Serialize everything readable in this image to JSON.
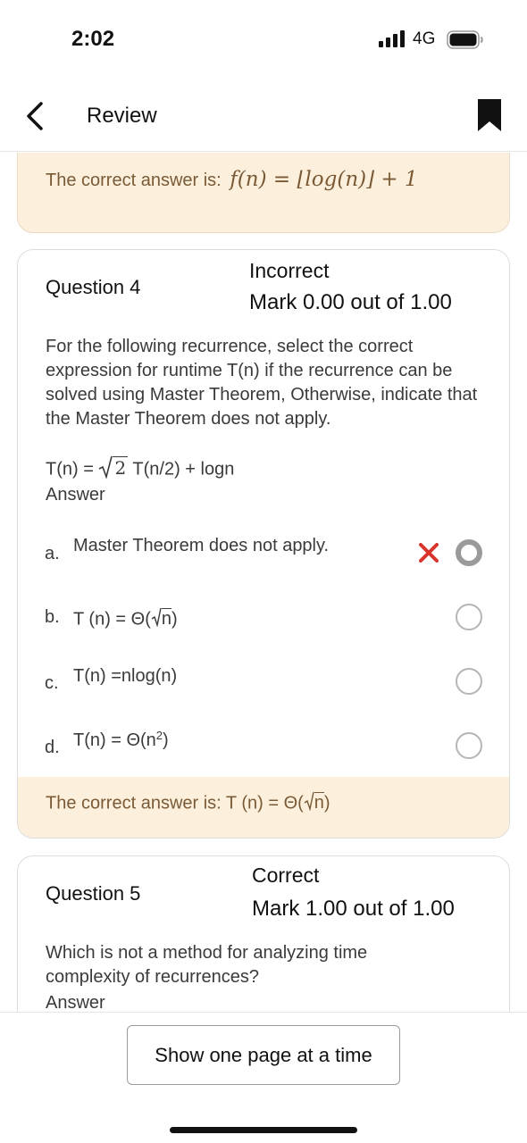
{
  "status_bar": {
    "time": "2:02",
    "network": "4G"
  },
  "nav": {
    "title": "Review"
  },
  "previous": {
    "answer_prefix": "The correct answer is:",
    "answer_math": "f(n) = ⌊log(n)⌋ + 1"
  },
  "question4": {
    "number": "Question 4",
    "status": "Incorrect",
    "mark": "Mark 0.00 out of 1.00",
    "text": "For the following recurrence, select the correct expression for runtime T(n) if the recurrence can be solved using Master Theorem, Otherwise, indicate that the Master Theorem does not apply.",
    "equation_left": "T(n) =",
    "equation_radicand": "2",
    "equation_right": "T(n/2) + logn",
    "answer_label": "Answer",
    "options": [
      {
        "letter": "a.",
        "text": "Master Theorem does not apply.",
        "selected": true,
        "marked_incorrect": true
      },
      {
        "letter": "b.",
        "text_before": "T (n) = Θ(",
        "text_radicand": "n",
        "text_after": ")",
        "selected": false
      },
      {
        "letter": "c.",
        "text": "T(n) =nlog(n)",
        "selected": false
      },
      {
        "letter": "d.",
        "text_before": "T(n) = Θ(n",
        "text_sup": "2",
        "text_after": ")",
        "selected": false
      }
    ],
    "correct_prefix": "The correct answer is: T (n) = Θ(",
    "correct_radicand": "n",
    "correct_suffix": ")"
  },
  "question5": {
    "number": "Question 5",
    "status": "Correct",
    "mark": "Mark 1.00 out of 1.00",
    "text": "Which is not a method for analyzing time complexity of recurrences?",
    "answer_label": "Answer"
  },
  "bottom": {
    "button_label": "Show one page at a time"
  },
  "colors": {
    "feedback_bg": "#fcf0dc",
    "feedback_text": "#7a5a36",
    "incorrect_x": "#d9342b"
  }
}
